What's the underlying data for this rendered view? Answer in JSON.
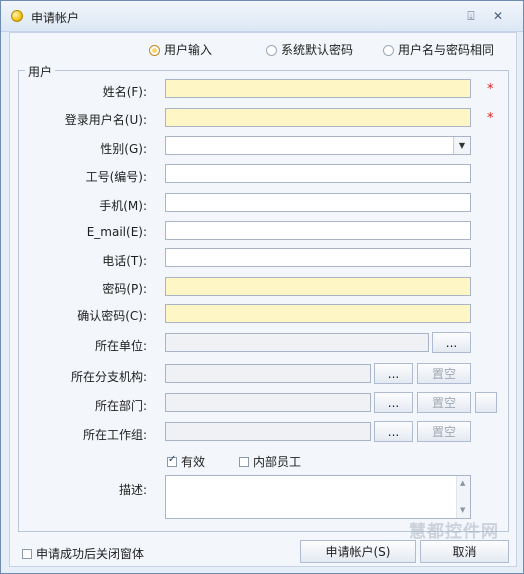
{
  "window": {
    "title": "申请帐户"
  },
  "mode_radios": [
    {
      "label": "用户输入",
      "checked": true
    },
    {
      "label": "系统默认密码",
      "checked": false
    },
    {
      "label": "用户名与密码相同",
      "checked": false
    }
  ],
  "group": {
    "title": "用户"
  },
  "labels": {
    "name": "姓名(F):",
    "login": "登录用户名(U):",
    "gender": "性别(G):",
    "workno": "工号(编号):",
    "mobile": "手机(M):",
    "email": "E_mail(E):",
    "phone": "电话(T):",
    "password": "密码(P):",
    "confirm": "确认密码(C):",
    "unit": "所在单位:",
    "branch": "所在分支机构:",
    "dept": "所在部门:",
    "workgroup": "所在工作组:",
    "description": "描述:"
  },
  "required_mark": "*",
  "buttons": {
    "browse": "...",
    "clear": "置空",
    "submit": "申请帐户(S)",
    "cancel": "取消"
  },
  "checks": {
    "valid": {
      "label": "有效",
      "checked": true
    },
    "internal": {
      "label": "内部员工",
      "checked": false
    }
  },
  "close_after": {
    "label": "申请成功后关闭窗体",
    "checked": false
  },
  "watermark": "慧都控件网"
}
